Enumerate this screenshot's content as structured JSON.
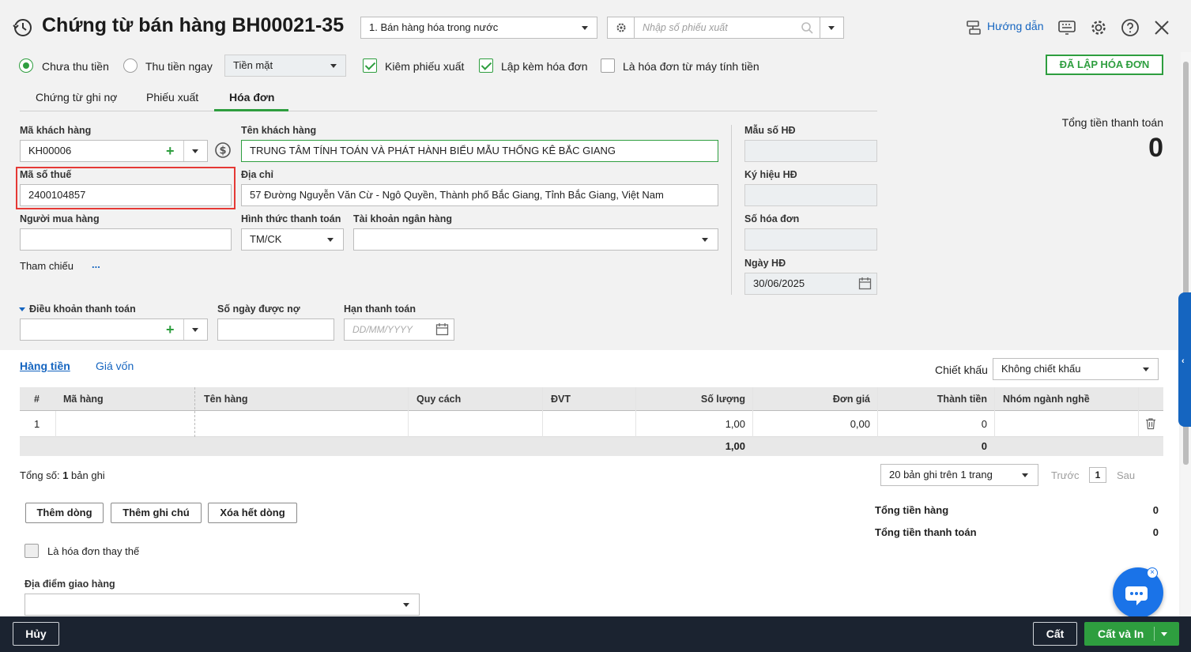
{
  "header": {
    "title": "Chứng từ bán hàng BH00021-35",
    "doc_type": "1. Bán hàng hóa trong nước",
    "search_placeholder": "Nhập số phiếu xuất",
    "guide": "Hướng dẫn"
  },
  "options": {
    "unpaid": "Chưa thu tiền",
    "paid_now": "Thu tiền ngay",
    "pay_method": "Tiền mặt",
    "export_slip": "Kiêm phiếu xuất",
    "with_invoice": "Lập kèm hóa đơn",
    "cash_register": "Là hóa đơn từ máy tính tiền",
    "issued_badge": "ĐÃ LẬP HÓA ĐƠN"
  },
  "tabs": [
    "Chứng từ ghi nợ",
    "Phiếu xuất",
    "Hóa đơn"
  ],
  "form": {
    "customer_code_label": "Mã khách hàng",
    "customer_code": "KH00006",
    "customer_name_label": "Tên khách hàng",
    "customer_name": "TRUNG TÂM TÍNH TOÁN VÀ PHÁT HÀNH BIỂU MẪU THỐNG KÊ BẮC GIANG",
    "tax_code_label": "Mã số thuế",
    "tax_code": "2400104857",
    "address_label": "Địa chỉ",
    "address": "57 Đường Nguyễn Văn Cừ - Ngô Quyền, Thành phố  Bắc Giang, Tỉnh Bắc Giang, Việt Nam",
    "buyer_label": "Người mua hàng",
    "buyer": "",
    "payment_form_label": "Hình thức thanh toán",
    "payment_form": "TM/CK",
    "bank_label": "Tài khoản ngân hàng",
    "bank": "",
    "reference_label": "Tham chiếu",
    "reference_more": "...",
    "terms_label": "Điều khoản thanh toán",
    "debt_days_label": "Số ngày được nợ",
    "due_label": "Hạn thanh toán",
    "due_placeholder": "DD/MM/YYYY"
  },
  "invoice": {
    "template_label": "Mẫu số HĐ",
    "symbol_label": "Ký hiệu HĐ",
    "number_label": "Số hóa đơn",
    "date_label": "Ngày HĐ",
    "date": "30/06/2025"
  },
  "total_box": {
    "label": "Tổng tiền thanh toán",
    "value": "0"
  },
  "detail_tabs": [
    "Hàng tiền",
    "Giá vốn"
  ],
  "discount": {
    "label": "Chiết khấu",
    "value": "Không chiết khấu"
  },
  "table": {
    "headers": [
      "#",
      "Mã hàng",
      "Tên hàng",
      "Quy cách",
      "ĐVT",
      "Số lượng",
      "Đơn giá",
      "Thành tiền",
      "Nhóm ngành nghề"
    ],
    "rows": [
      {
        "no": "1",
        "code": "",
        "name": "",
        "spec": "",
        "unit": "",
        "qty": "1,00",
        "price": "0,00",
        "amount": "0",
        "group": ""
      }
    ],
    "footer": {
      "qty": "1,00",
      "amount": "0"
    }
  },
  "paging": {
    "total_prefix": "Tổng số: ",
    "total_count": "1",
    "total_suffix": " bản ghi",
    "per_page": "20 bản ghi trên 1 trang",
    "prev": "Trước",
    "page": "1",
    "next": "Sau"
  },
  "actions": {
    "add_row": "Thêm dòng",
    "add_note": "Thêm ghi chú",
    "clear_rows": "Xóa hết dòng"
  },
  "summary": {
    "goods_label": "Tổng tiền hàng",
    "goods": "0",
    "pay_label": "Tổng tiền thanh toán",
    "pay": "0"
  },
  "replace_invoice": "Là hóa đơn thay thế",
  "delivery_label": "Địa điểm giao hàng",
  "footer": {
    "cancel": "Hủy",
    "save": "Cất",
    "save_print": "Cất và In"
  },
  "colors": {
    "green": "#2e9e3f",
    "blue": "#1565c0",
    "highlight": "#e53935",
    "footer_bg": "#1b2330"
  }
}
